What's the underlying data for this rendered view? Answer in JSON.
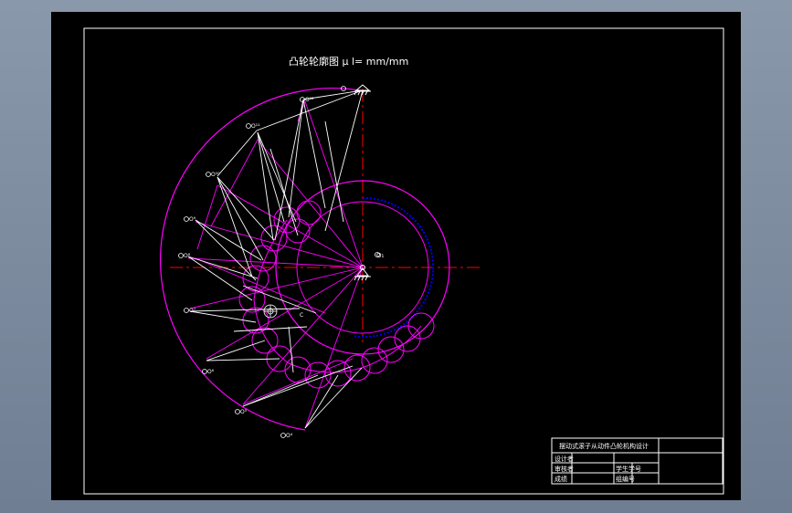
{
  "drawing": {
    "title": "凸轮轮廓图 μ l= mm/mm",
    "center_label": "O₁",
    "labels": {
      "p12": "O¹²",
      "p11": "O¹¹",
      "p10": "O¹⁰",
      "p9": "O⁹",
      "p8": "O⁸",
      "p7": "O⁷",
      "p6": "O⁶",
      "p5": "O⁵",
      "p4": "O⁴",
      "pc": "C"
    }
  },
  "title_block": {
    "heading": "摆动式滚子从动件凸轮机构设计",
    "row1": "设计者",
    "row2": "审核者",
    "row3": "成绩",
    "cell_a": "学生学号",
    "cell_b": "组编号"
  },
  "colors": {
    "sheet": "#000000",
    "magenta": "#ff00ff",
    "white": "#ffffff",
    "red": "#ff0000",
    "blue": "#0000ff"
  }
}
